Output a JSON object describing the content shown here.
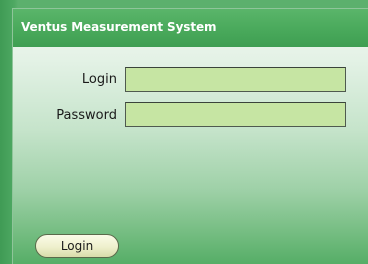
{
  "window": {
    "title": "Ventus Measurement System"
  },
  "form": {
    "login_label": "Login",
    "login_value": "",
    "password_label": "Password",
    "password_value": "",
    "submit_label": "Login"
  },
  "colors": {
    "background_green": "#5cb06d",
    "title_bar": "#48a85a",
    "input_fill": "#c6e5a3",
    "button_fill": "#eef0cc"
  }
}
